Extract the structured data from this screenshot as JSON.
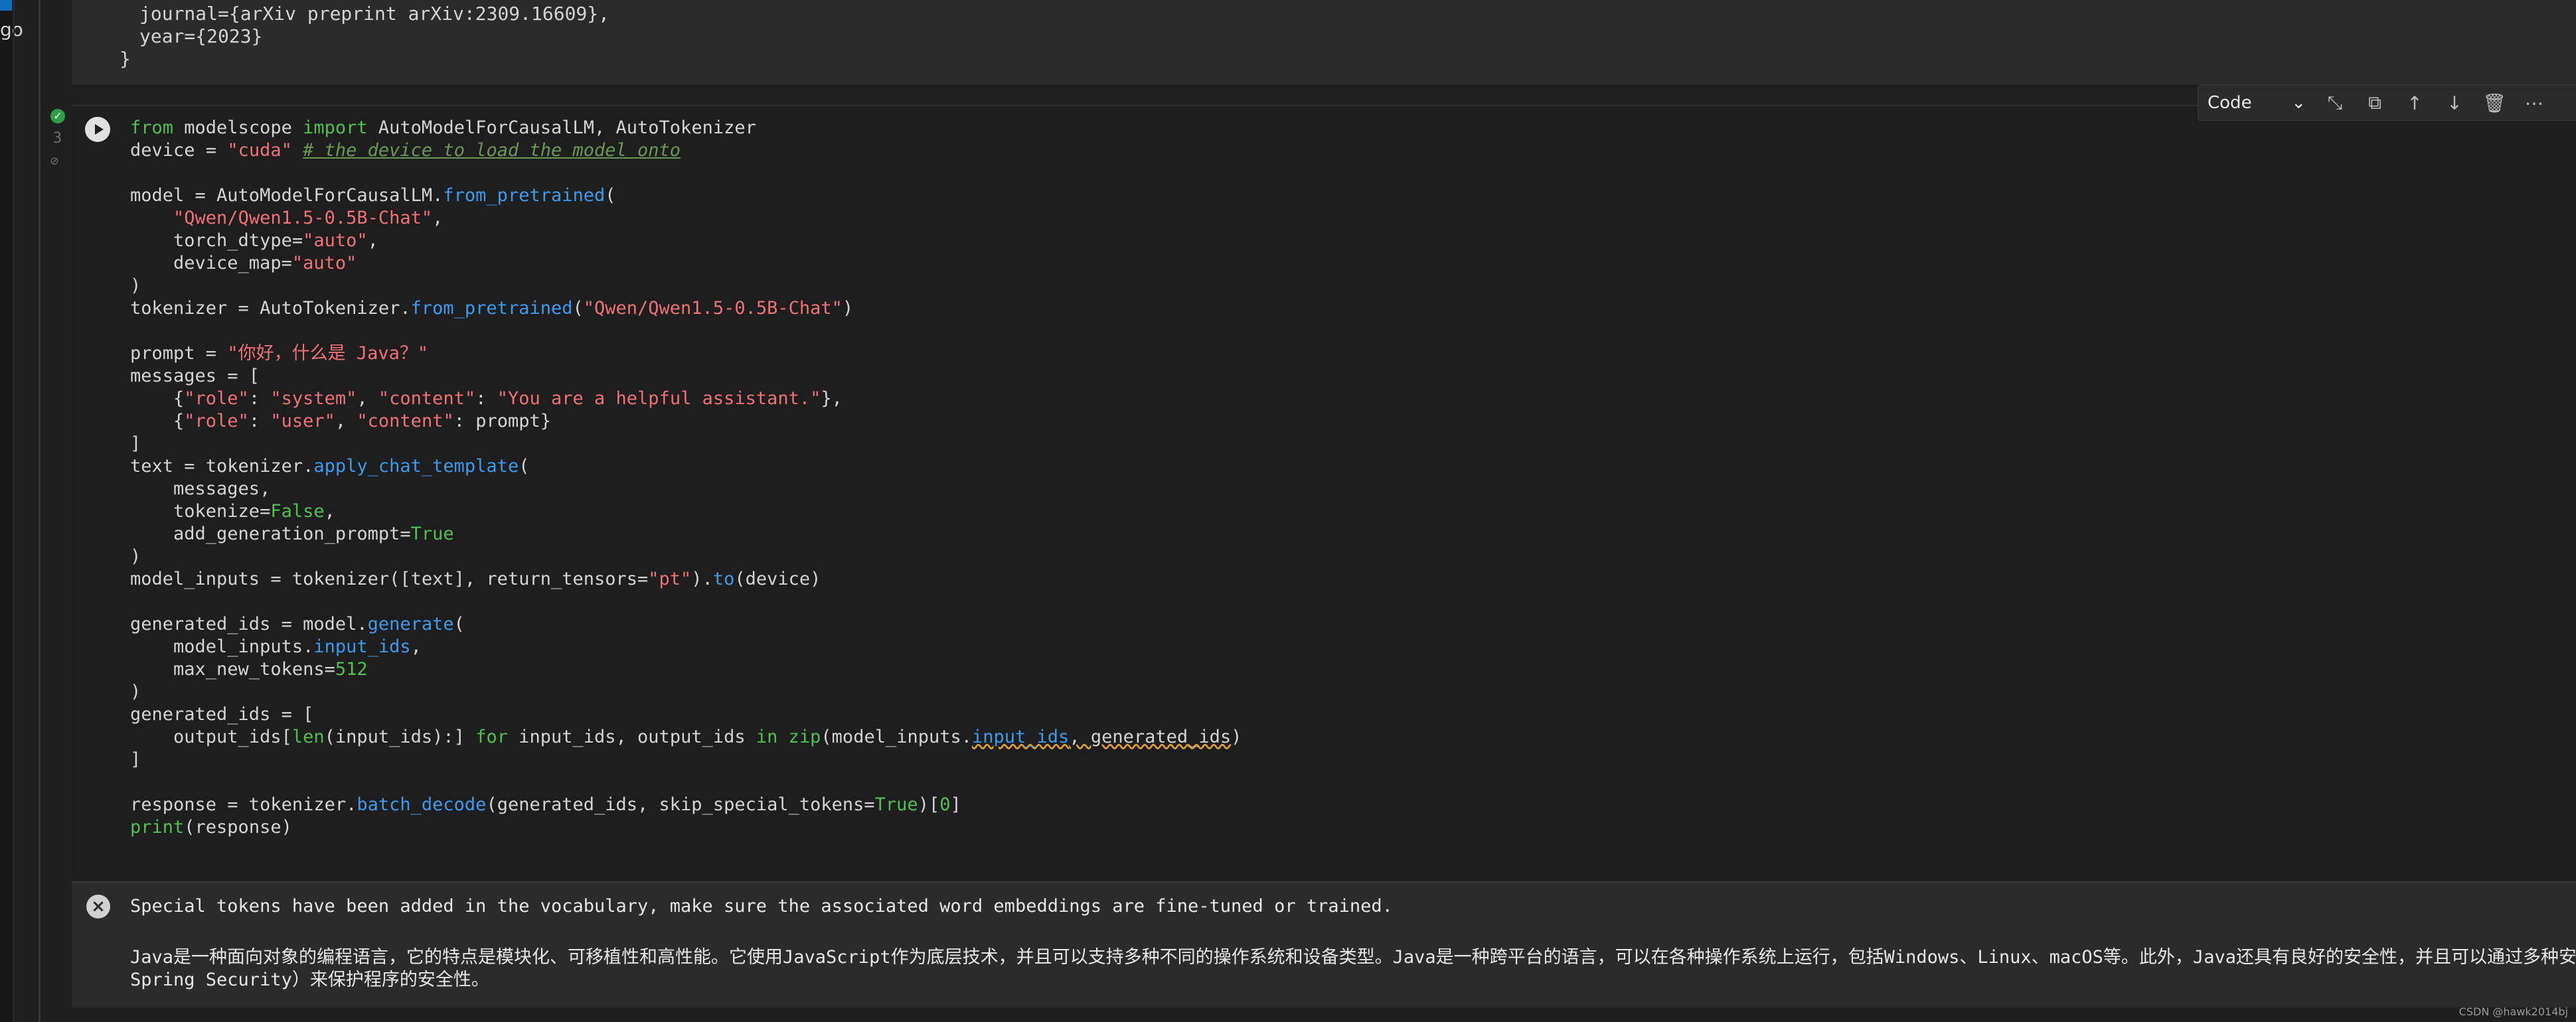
{
  "left_fragment": "go",
  "prev_cell": {
    "lines": [
      "journal={arXiv preprint arXiv:2309.16609},",
      "year={2023}",
      "}"
    ]
  },
  "cell": {
    "exec_count": "3",
    "status_icon": "check-circle-icon"
  },
  "toolbar": {
    "cell_type": "Code",
    "buttons": [
      "chevron-down-icon",
      "split-cell-icon",
      "copy-icon",
      "move-up-icon",
      "move-down-icon",
      "trash-icon",
      "more-icon"
    ]
  },
  "code_lines": [
    "from modelscope import AutoModelForCausalLM, AutoTokenizer",
    "device = \"cuda\" # the device to load the model onto",
    "",
    "model = AutoModelForCausalLM.from_pretrained(",
    "    \"Qwen/Qwen1.5-0.5B-Chat\",",
    "    torch_dtype=\"auto\",",
    "    device_map=\"auto\"",
    ")",
    "tokenizer = AutoTokenizer.from_pretrained(\"Qwen/Qwen1.5-0.5B-Chat\")",
    "",
    "prompt = \"你好，什么是 Java？\"",
    "messages = [",
    "    {\"role\": \"system\", \"content\": \"You are a helpful assistant.\"},",
    "    {\"role\": \"user\", \"content\": prompt}",
    "]",
    "text = tokenizer.apply_chat_template(",
    "    messages,",
    "    tokenize=False,",
    "    add_generation_prompt=True",
    ")",
    "model_inputs = tokenizer([text], return_tensors=\"pt\").to(device)",
    "",
    "generated_ids = model.generate(",
    "    model_inputs.input_ids,",
    "    max_new_tokens=512",
    ")",
    "generated_ids = [",
    "    output_ids[len(input_ids):] for input_ids, output_ids in zip(model_inputs.input_ids, generated_ids)",
    "]",
    "",
    "response = tokenizer.batch_decode(generated_ids, skip_special_tokens=True)[0]",
    "print(response)"
  ],
  "output": {
    "line1": "Special tokens have been added in the vocabulary, make sure the associated word embeddings are fine-tuned or trained.",
    "line2": "Java是一种面向对象的编程语言，它的特点是模块化、可移植性和高性能。它使用JavaScript作为底层技术，并且可以支持多种不同的操作系统和设备类型。Java是一种跨平台的语言，可以在各种操作系统上运行，包括Windows、Linux、macOS等。此外，Java还具有良好的安全性，并且可以通过多种安全框架（如",
    "line3": "Spring Security）来保护程序的安全性。"
  },
  "watermark": "CSDN @hawk2014bj"
}
